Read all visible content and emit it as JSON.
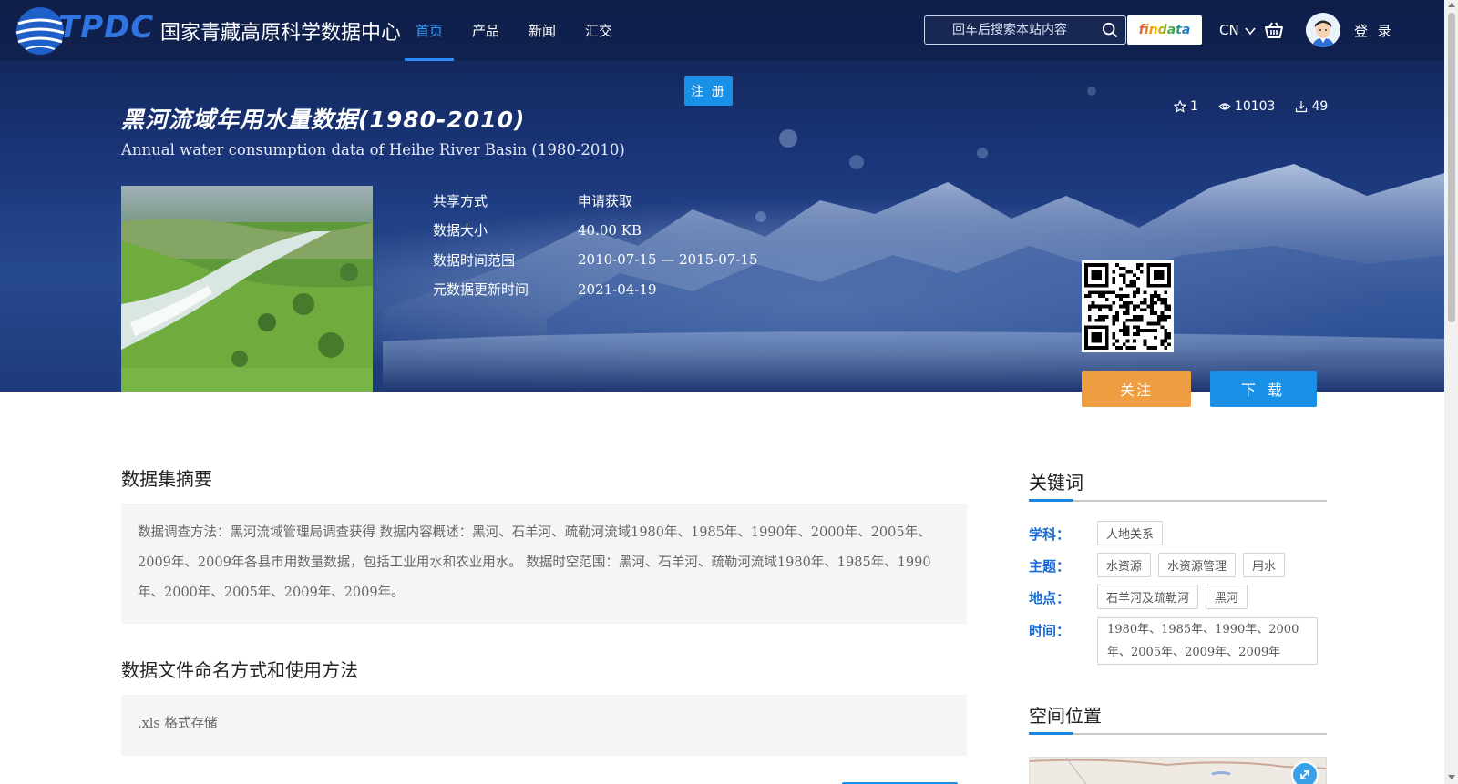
{
  "header": {
    "logo_abbr": "TPDC",
    "logo_name": "国家青藏高原科学数据中心",
    "nav": [
      "首页",
      "产品",
      "新闻",
      "汇交"
    ],
    "active_nav": "首页",
    "search_placeholder": "回车后搜索本站内容",
    "findata_label": "findata",
    "lang": "CN",
    "login": "登 录",
    "icons": [
      "search-icon",
      "chevron-down-icon",
      "cart-icon",
      "avatar"
    ]
  },
  "register_label": "注 册",
  "dataset": {
    "title": "黑河流域年用水量数据(1980-2010)",
    "subtitle": "Annual water consumption data of Heihe River Basin (1980-2010)",
    "stats": {
      "stars": "1",
      "views": "10103",
      "downloads": "49"
    },
    "meta": [
      {
        "label": "共享方式",
        "value": "申请获取"
      },
      {
        "label": "数据大小",
        "value": "40.00 KB"
      },
      {
        "label": "数据时间范围",
        "value": "2010-07-15 — 2015-07-15"
      },
      {
        "label": "元数据更新时间",
        "value": "2021-04-19"
      }
    ],
    "follow_label": "关注",
    "download_label": "下 载"
  },
  "summary": {
    "title": "数据集摘要",
    "text": "数据调查方法：黑河流域管理局调查获得 数据内容概述：黑河、石羊河、疏勒河流域1980年、1985年、1990年、2000年、2005年、2009年、2009年各县市用数量数据，包括工业用水和农业用水。 数据时空范围：黑河、石羊河、疏勒河流域1980年、1985年、1990年、2000年、2005年、2009年、2009年。"
  },
  "file_naming": {
    "title": "数据文件命名方式和使用方法",
    "text": ".xls 格式存储"
  },
  "keywords": {
    "title": "关键词",
    "rows": [
      {
        "label": "学科：",
        "tags": [
          "人地关系"
        ]
      },
      {
        "label": "主题：",
        "tags": [
          "水资源",
          "水资源管理",
          "用水"
        ]
      },
      {
        "label": "地点：",
        "tags": [
          "石羊河及疏勒河",
          "黑河"
        ]
      },
      {
        "label": "时间：",
        "tags": [
          "1980年、1985年、1990年、2000年、2005年、2009年、2009年"
        ]
      }
    ]
  },
  "location": {
    "title": "空间位置"
  },
  "colors": {
    "nav_active": "#3aa0ff",
    "primary_blue": "#1890e8",
    "follow_orange": "#ee9d40",
    "keyword_label": "#1a6bd1",
    "hero_dark": "#0f1f4c"
  }
}
